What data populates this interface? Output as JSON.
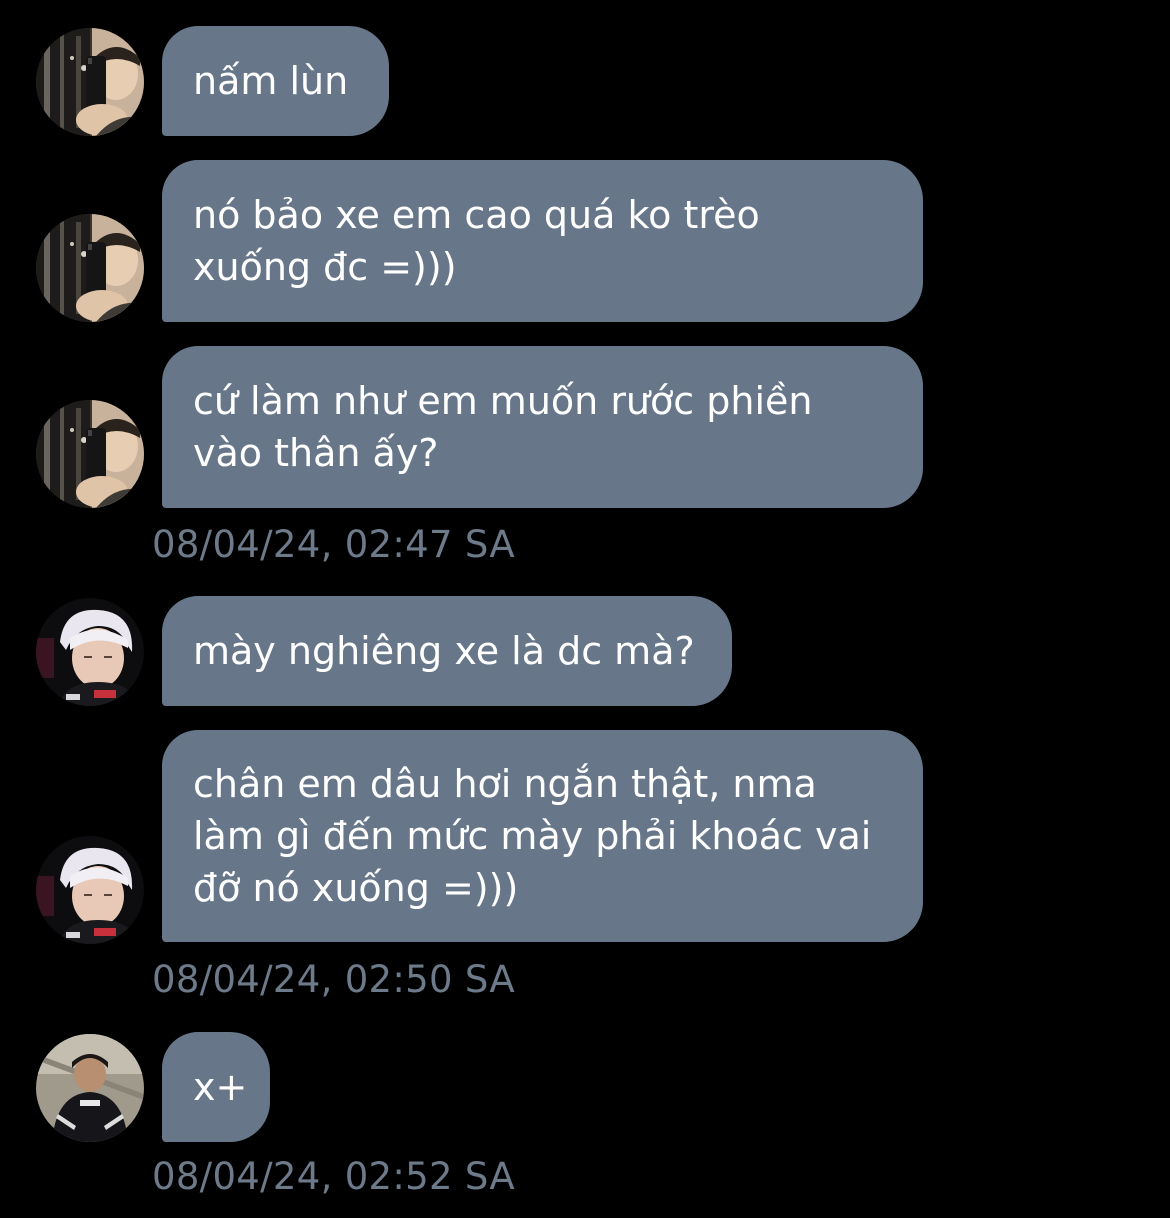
{
  "messages": [
    {
      "text": "nấm lùn",
      "avatar_icon": "user-avatar-mirror-selfie"
    },
    {
      "text": "nó bảo xe em cao quá ko trèo\nxuống đc =)))",
      "avatar_icon": "user-avatar-mirror-selfie"
    },
    {
      "text": "cứ làm như em muốn rước phiền\nvào thân ấy?",
      "avatar_icon": "user-avatar-mirror-selfie"
    },
    {
      "text": "mày nghiêng xe là dc mà?",
      "avatar_icon": "user-avatar-white-hair"
    },
    {
      "text": "chân em dâu hơi ngắn thật, nma\nlàm gì đến mức mày phải khoác vai\nđỡ nó xuống =)))",
      "avatar_icon": "user-avatar-white-hair"
    },
    {
      "text": "x+",
      "avatar_icon": "user-avatar-dark-jacket"
    }
  ],
  "timestamps": [
    "08/04/24, 02:47 SA",
    "08/04/24, 02:50 SA",
    "08/04/24, 02:52 SA"
  ],
  "colors": {
    "background": "#000000",
    "bubble": "#677789",
    "bubble_text": "#ffffff",
    "timestamp": "#6c7a8a"
  }
}
